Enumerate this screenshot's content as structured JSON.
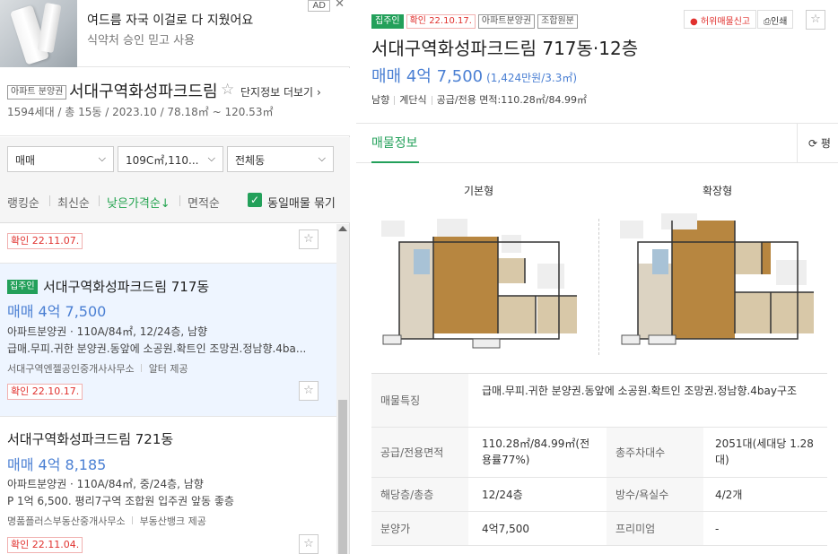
{
  "ad": {
    "title": "여드름 자국 이걸로 다 지웠어요",
    "subtitle": "식약처 승인 믿고 사용",
    "badge": "AD",
    "close": "✕"
  },
  "complex": {
    "tag": "아파트 분양권",
    "name": "서대구역화성파크드림",
    "more": "단지정보 더보기",
    "info": "1594세대 / 총 15동 / 2023.10 / 78.18㎡ ~ 120.53㎡"
  },
  "filters": {
    "trade_type": "매매",
    "area": "109C㎡,110...",
    "building": "전체동",
    "sorts": [
      "랭킹순",
      "최신순",
      "낮은가격순↓",
      "면적순"
    ],
    "active_sort_index": 2,
    "same_listing_label": "동일매물 묶기",
    "same_listing_checked": true
  },
  "listings": [
    {
      "confirm": "확인 22.11.07."
    },
    {
      "badge": "집주인",
      "title": "서대구역화성파크드림 717동",
      "price": "매매 4억 7,500",
      "line1": "아파트분양권 · 110A/84㎡, 12/24층, 남향",
      "line2": "급매.무피.귀한 분양권.동앞에 소공원.확트인 조망권.정남향.4ba...",
      "agent": "서대구역엔젤공인중개사사무소",
      "provider": "알터 제공",
      "confirm": "확인 22.10.17."
    },
    {
      "title": "서대구역화성파크드림 721동",
      "price": "매매 4억 8,185",
      "line1": "아파트분양권 · 110A/84㎡, 중/24층, 남향",
      "line2": "P 1억 6,500. 평리7구역 조합원 입주권 앞동 좋층",
      "agent": "명품플러스부동산중개사무소",
      "provider": "부동산뱅크 제공",
      "confirm": "확인 22.11.04."
    }
  ],
  "detail": {
    "tags": [
      "집주인",
      "확인 22.10.17.",
      "아파트분양권",
      "조합원분"
    ],
    "report": "허위매물신고",
    "print": "인쇄",
    "title": "서대구역화성파크드림 717동·12층",
    "price": "매매 4억 7,500",
    "price_unit": "(1,424만원/3.3㎡)",
    "summary": [
      "남향",
      "계단식",
      "공급/전용 면적:110.28㎡/84.99㎡"
    ],
    "tab": "매물정보",
    "pyeong_tab": "평",
    "floorplan_labels": [
      "기본형",
      "확장형"
    ],
    "rows": [
      {
        "label": "매물특징",
        "value": "급매.무피.귀한 분양권.동앞에 소공원.확트인 조망권.정남향.4bay구조"
      },
      {
        "label": "공급/전용면적",
        "value": "110.28㎡/84.99㎡(전용률77%)",
        "label2": "총주차대수",
        "value2": "2051대(세대당 1.28대)"
      },
      {
        "label": "해당층/총층",
        "value": "12/24층",
        "label2": "방수/욕실수",
        "value2": "4/2개"
      },
      {
        "label": "분양가",
        "value": "4억7,500",
        "label2": "프리미엄",
        "value2": "-"
      }
    ]
  },
  "colors": {
    "accent_green": "#23a05a",
    "price_blue": "#4a7fd3",
    "confirm_red": "#e0312e",
    "selected_row": "#eef5ff"
  }
}
